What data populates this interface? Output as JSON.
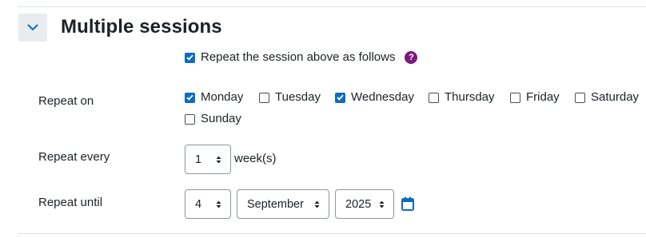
{
  "section": {
    "title": "Multiple sessions"
  },
  "repeat_session": {
    "label": "Repeat the session above as follows",
    "checked": true,
    "help_icon": "question-circle-icon"
  },
  "repeat_on": {
    "label": "Repeat on",
    "days": [
      {
        "label": "Monday",
        "checked": true
      },
      {
        "label": "Tuesday",
        "checked": false
      },
      {
        "label": "Wednesday",
        "checked": true
      },
      {
        "label": "Thursday",
        "checked": false
      },
      {
        "label": "Friday",
        "checked": false
      },
      {
        "label": "Saturday",
        "checked": false
      },
      {
        "label": "Sunday",
        "checked": false
      }
    ]
  },
  "repeat_every": {
    "label": "Repeat every",
    "value": "1",
    "unit": "week(s)"
  },
  "repeat_until": {
    "label": "Repeat until",
    "day": "4",
    "month": "September",
    "year": "2025",
    "calendar_icon": "calendar-icon"
  },
  "colors": {
    "accent": "#0f6cbf",
    "help": "#7c1a7e",
    "collapse_bg": "#e9ecef"
  }
}
